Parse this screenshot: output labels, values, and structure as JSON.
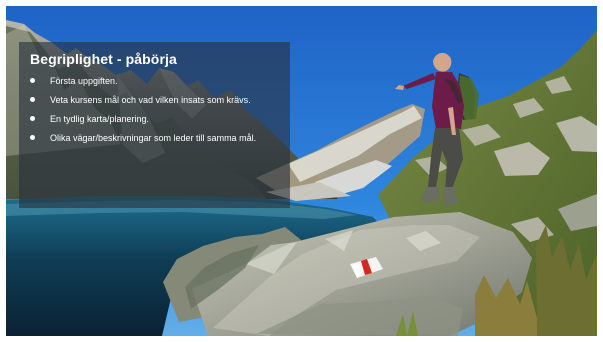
{
  "slide": {
    "title": "Begriplighet - påbörja",
    "bullets": [
      "Första uppgiften.",
      "Veta kursens mål och vad vilken insats som krävs.",
      "En tydlig karta/planering.",
      "Olika vägar/beskrivningar som leder till samma mål."
    ]
  },
  "colors": {
    "panel": "#28303E",
    "sky": "#2A78D0",
    "lake": "#0F3347",
    "trail_marker_red": "#D12A1F",
    "trail_marker_white": "#F4F4F4"
  }
}
